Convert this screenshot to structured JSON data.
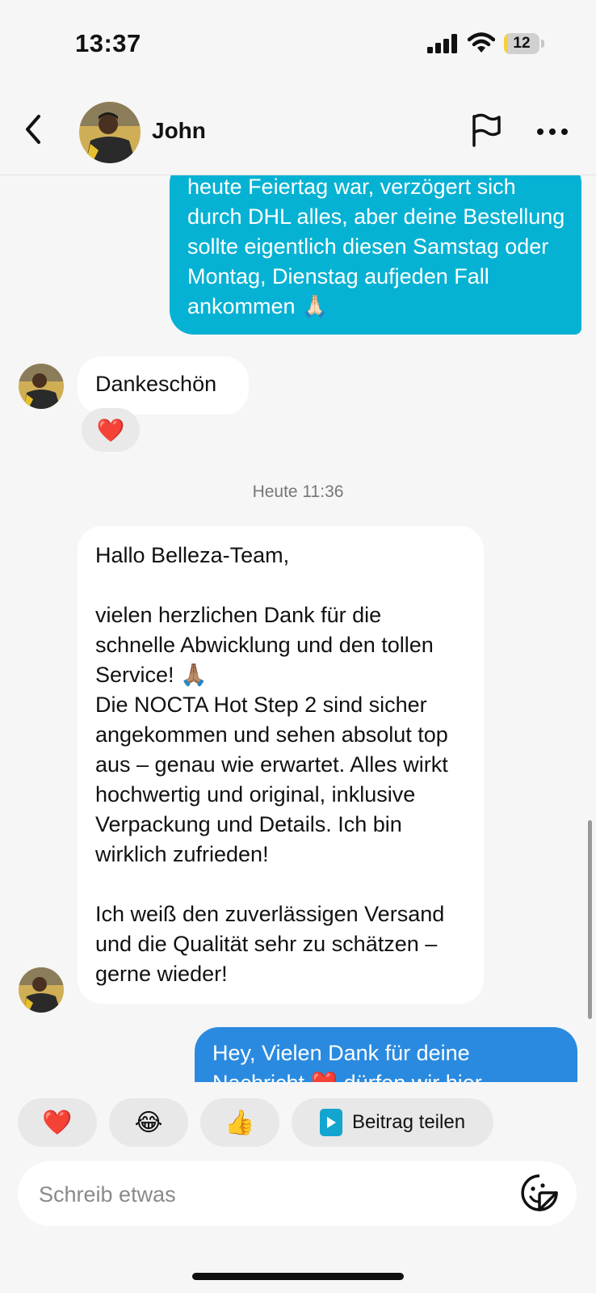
{
  "status_bar": {
    "time": "13:37",
    "battery": "12",
    "battery_level": 0.12
  },
  "header": {
    "contact_name": "John"
  },
  "chat": {
    "messages": [
      {
        "direction": "outgoing",
        "text": "heute Feiertag war, verzögert sich durch DHL alles, aber deine Bestellung sollte eigentlich diesen Samstag oder Montag, Dienstag aufjeden Fall ankommen 🙏🏻"
      },
      {
        "direction": "incoming",
        "text": "Dankeschön",
        "reaction": "❤️"
      },
      {
        "direction": "incoming",
        "text": "Hallo Belleza-Team,\n\nvielen herzlichen Dank für die schnelle Abwicklung und den tollen Service! 🙏🏽\nDie NOCTA Hot Step 2 sind sicher angekommen und sehen absolut top aus – genau wie erwartet. Alles wirkt hochwertig und original, inklusive Verpackung und Details. Ich bin wirklich zufrieden!\n\nIch weiß den zuverlässigen Versand und die Qualität sehr zu schätzen – gerne wieder!"
      },
      {
        "direction": "outgoing",
        "text": "Hey, Vielen Dank für deine Nachricht ❤️ dürfen wir hier"
      }
    ],
    "timestamp": "Heute 11:36"
  },
  "quick_reactions": {
    "heart": "❤️",
    "laugh": "😂",
    "thumbs_up": "👍",
    "share_label": "Beitrag teilen"
  },
  "composer": {
    "placeholder": "Schreib etwas"
  },
  "colors": {
    "outgoing_bubble": "#06b2d3",
    "outgoing_bubble_latest": "#2a8ae0",
    "incoming_bubble": "#ffffff",
    "background": "#f6f6f6",
    "reaction_heart": "#e8262c"
  },
  "icons": [
    "back-chevron-icon",
    "flag-icon",
    "more-icon",
    "cellular-signal-icon",
    "wifi-icon",
    "battery-icon",
    "share-post-icon",
    "sticker-icon"
  ]
}
